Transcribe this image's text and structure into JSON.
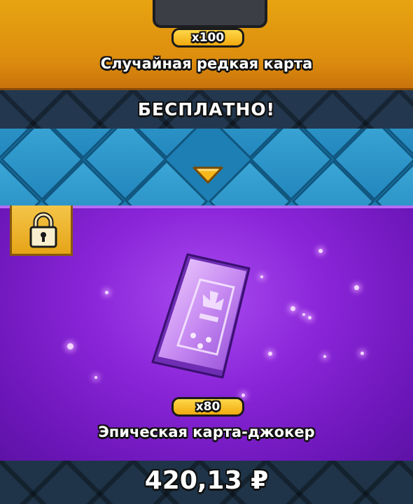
{
  "gold_offer": {
    "quantity": "x100",
    "title": "Случайная редкая карта"
  },
  "free": {
    "label": "БЕСПЛАТНО!"
  },
  "epic_offer": {
    "quantity": "x80",
    "title": "Эпическая карта-джокер",
    "locked": true
  },
  "price": {
    "label": "420,13 ₽"
  },
  "icons": [
    "lock-icon",
    "chevron-down-icon",
    "epic-joker-card-icon"
  ],
  "colors": {
    "gold_panel": "#e39a0f",
    "purple_panel": "#8a25d8",
    "blue_zone": "#1d7fb3",
    "badge": "#f5b51a"
  }
}
